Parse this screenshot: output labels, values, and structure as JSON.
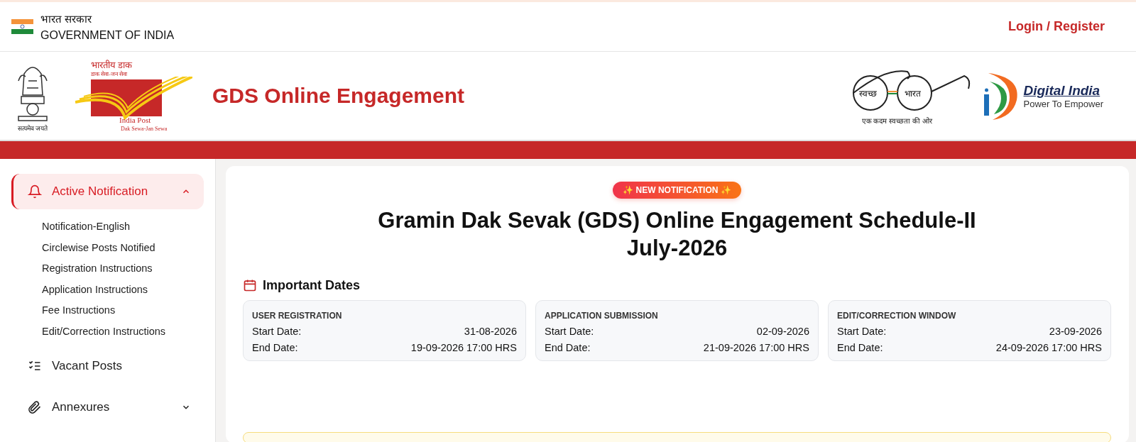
{
  "top_bar": {
    "hindi_label": "भारत सरकार",
    "label": "GOVERNMENT OF INDIA",
    "login_link": "Login / Register"
  },
  "header": {
    "emblem_motto": "सत्यमेव जयते",
    "india_post_logo": {
      "hindi_name": "भारतीय डाक",
      "hindi_tagline": "डाक सेवा-जन सेवा",
      "name": "India Post",
      "tagline": "Dak Sewa-Jan Sewa"
    },
    "site_title": "GDS Online Engagement",
    "swachh_bharat_logo": {
      "left_lens": "स्वच्छ",
      "right_lens": "भारत",
      "tagline": "एक कदम स्वच्छता की ओर"
    },
    "digital_india_logo": {
      "name": "Digital India",
      "tagline": "Power To Empower"
    }
  },
  "sidebar": {
    "items": [
      {
        "kind": "bell",
        "label": "Active Notification",
        "selected": true,
        "expanded": true,
        "children": [
          {
            "label": "Notification-English",
            "selected": false
          },
          {
            "label": "Circlewise Posts Notified",
            "selected": false
          },
          {
            "label": "Registration Instructions",
            "selected": false
          },
          {
            "label": "Application Instructions",
            "selected": false
          },
          {
            "label": "Fee Instructions",
            "selected": false
          },
          {
            "label": "Edit/Correction Instructions",
            "selected": false
          }
        ]
      },
      {
        "kind": "checklist",
        "label": "Vacant Posts",
        "selected": false
      },
      {
        "kind": "paperclip",
        "label": "Annexures",
        "selected": false,
        "expanded": false
      }
    ]
  },
  "main": {
    "badge": "✨ NEW NOTIFICATION ✨",
    "title_lines": [
      "Gramin Dak Sevak (GDS) Online Engagement Schedule-II",
      "July-2026"
    ],
    "important_dates": {
      "heading": "Important Dates",
      "cards": [
        {
          "title": "USER REGISTRATION",
          "rows": [
            {
              "label": "Start Date:",
              "value": "31-08-2026"
            },
            {
              "label": "End Date:",
              "value": "19-09-2026 17:00 HRS"
            }
          ]
        },
        {
          "title": "APPLICATION SUBMISSION",
          "rows": [
            {
              "label": "Start Date:",
              "value": "02-09-2026"
            },
            {
              "label": "End Date:",
              "value": "21-09-2026 17:00 HRS"
            }
          ]
        },
        {
          "title": "EDIT/CORRECTION WINDOW",
          "rows": [
            {
              "label": "Start Date:",
              "value": "23-09-2026"
            },
            {
              "label": "End Date:",
              "value": "24-09-2026 17:00 HRS"
            }
          ]
        }
      ]
    }
  }
}
